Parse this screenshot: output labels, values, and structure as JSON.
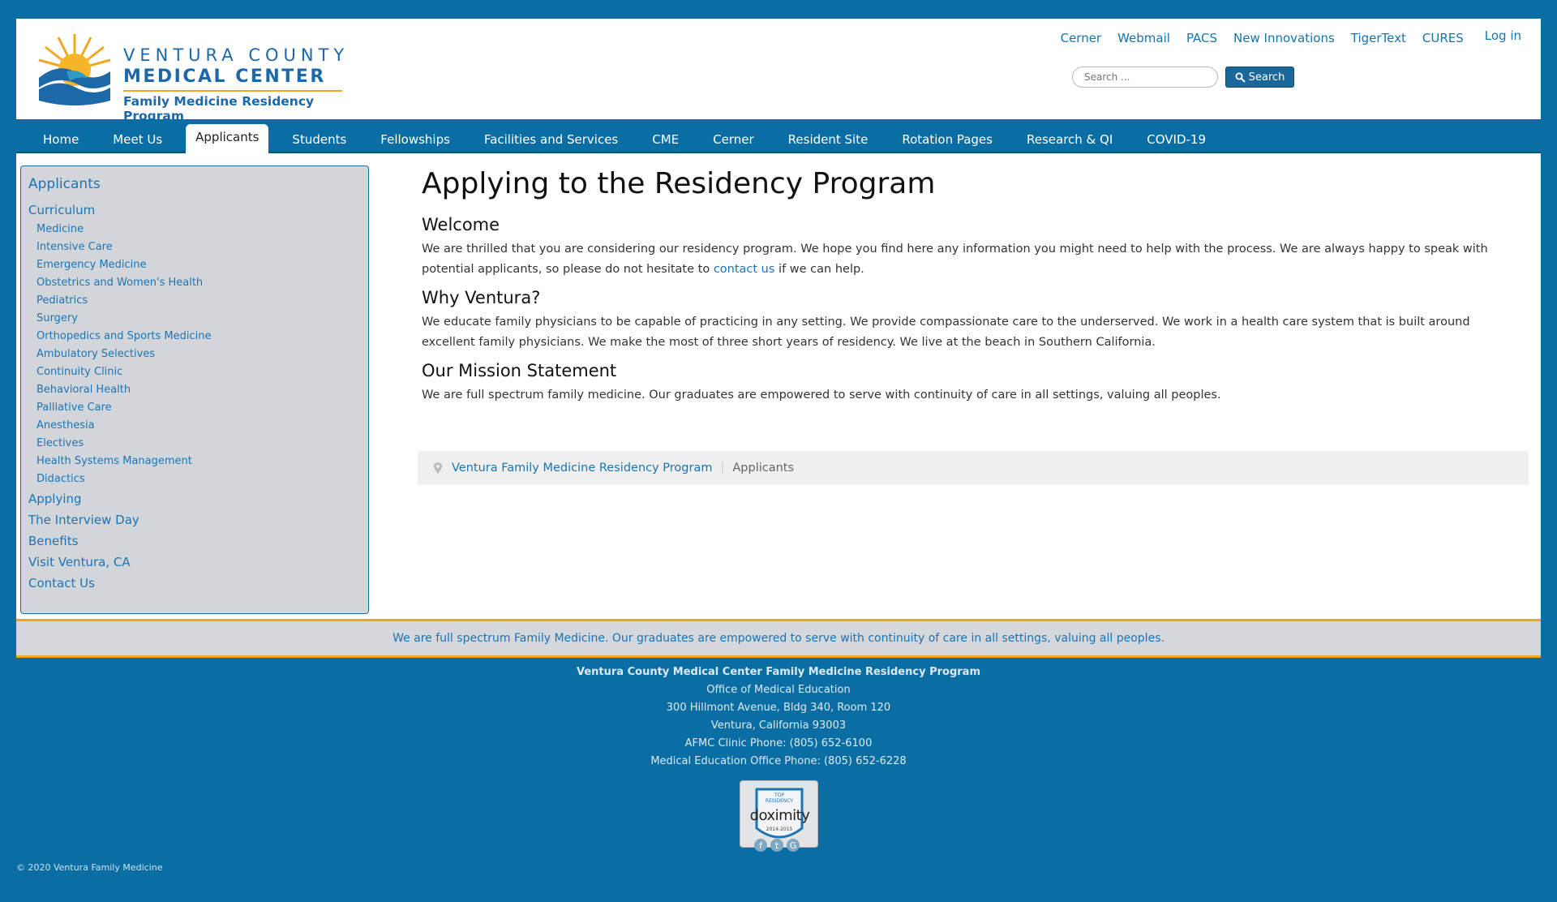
{
  "logo": {
    "line1": "VENTURA COUNTY",
    "line2": "MEDICAL CENTER",
    "line3": "Family Medicine Residency Program"
  },
  "top_links": [
    "Cerner",
    "Webmail",
    "PACS",
    "New Innovations",
    "TigerText",
    "CURES"
  ],
  "login_label": "Log in",
  "search": {
    "placeholder": "Search ...",
    "button_label": "Search"
  },
  "nav": {
    "tabs": [
      "Home",
      "Meet Us",
      "Applicants",
      "Students",
      "Fellowships",
      "Facilities and Services",
      "CME",
      "Cerner",
      "Resident Site",
      "Rotation Pages",
      "Research & QI",
      "COVID-19"
    ],
    "active": "Applicants"
  },
  "sidebar": {
    "heading": "Applicants",
    "curriculum": "Curriculum",
    "curriculum_items": [
      "Medicine",
      "Intensive Care",
      "Emergency Medicine",
      "Obstetrics and Women's Health",
      "Pediatrics",
      "Surgery",
      "Orthopedics and Sports Medicine",
      "Ambulatory Selectives",
      "Continuity Clinic",
      "Behavioral Health",
      "Palliative Care",
      "Anesthesia",
      "Electives",
      "Health Systems Management",
      "Didactics"
    ],
    "items": [
      "Applying",
      "The Interview Day",
      "Benefits",
      "Visit Ventura, CA",
      "Contact Us"
    ]
  },
  "content": {
    "title": "Applying to the Residency Program",
    "welcome_heading": "Welcome",
    "welcome_text_1": "We are thrilled that you are considering our residency program. We hope you find here any information you might need to help with the process. We are always happy to speak with potential applicants, so please do not hesitate to ",
    "welcome_link": "contact us",
    "welcome_text_2": " if we can help.",
    "why_heading": "Why Ventura?",
    "why_text": "We educate family physicians to be capable of practicing in any setting.  We provide compassionate care to the underserved.  We work in a health care system that is built around excellent family physicians.  We make the most of three short years of residency.  We live at the beach in Southern California.",
    "mission_heading": "Our Mission Statement",
    "mission_text": "We are full spectrum family medicine.  Our graduates are empowered to serve with continuity of care in all settings, valuing all peoples."
  },
  "breadcrumb": {
    "link": "Ventura Family Medicine Residency Program",
    "current": "Applicants"
  },
  "mission_banner": "We are full spectrum Family Medicine. Our graduates are empowered to serve with continuity of care in all settings, valuing all peoples.",
  "footer": {
    "org": "Ventura County Medical Center Family Medicine Residency Program",
    "lines": [
      "Office of Medical Education",
      "300 Hillmont Avenue, Bldg 340, Room 120",
      "Ventura, California 93003",
      "AFMC Clinic Phone: (805) 652-6100",
      "Medical Education Office Phone: (805) 652-6228"
    ]
  },
  "badge": {
    "top": "TOP RESIDENCY",
    "name": "doximity",
    "years": "2014-2015"
  },
  "social_icons": [
    "facebook-icon",
    "twitter-icon",
    "google-icon"
  ],
  "copyright": "© 2020 Ventura Family Medicine",
  "colors": {
    "brand_blue": "#0a6ea4",
    "link_blue": "#1c74b4",
    "accent_gold": "#f2a41c"
  }
}
